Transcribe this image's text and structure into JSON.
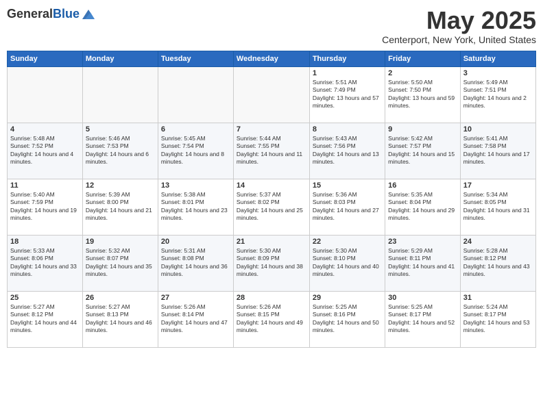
{
  "header": {
    "logo_general": "General",
    "logo_blue": "Blue",
    "month_title": "May 2025",
    "location": "Centerport, New York, United States"
  },
  "calendar": {
    "days_of_week": [
      "Sunday",
      "Monday",
      "Tuesday",
      "Wednesday",
      "Thursday",
      "Friday",
      "Saturday"
    ],
    "weeks": [
      [
        {
          "day": "",
          "info": ""
        },
        {
          "day": "",
          "info": ""
        },
        {
          "day": "",
          "info": ""
        },
        {
          "day": "",
          "info": ""
        },
        {
          "day": "1",
          "sunrise": "5:51 AM",
          "sunset": "7:49 PM",
          "daylight": "13 hours and 57 minutes."
        },
        {
          "day": "2",
          "sunrise": "5:50 AM",
          "sunset": "7:50 PM",
          "daylight": "13 hours and 59 minutes."
        },
        {
          "day": "3",
          "sunrise": "5:49 AM",
          "sunset": "7:51 PM",
          "daylight": "14 hours and 2 minutes."
        }
      ],
      [
        {
          "day": "4",
          "sunrise": "5:48 AM",
          "sunset": "7:52 PM",
          "daylight": "14 hours and 4 minutes."
        },
        {
          "day": "5",
          "sunrise": "5:46 AM",
          "sunset": "7:53 PM",
          "daylight": "14 hours and 6 minutes."
        },
        {
          "day": "6",
          "sunrise": "5:45 AM",
          "sunset": "7:54 PM",
          "daylight": "14 hours and 8 minutes."
        },
        {
          "day": "7",
          "sunrise": "5:44 AM",
          "sunset": "7:55 PM",
          "daylight": "14 hours and 11 minutes."
        },
        {
          "day": "8",
          "sunrise": "5:43 AM",
          "sunset": "7:56 PM",
          "daylight": "14 hours and 13 minutes."
        },
        {
          "day": "9",
          "sunrise": "5:42 AM",
          "sunset": "7:57 PM",
          "daylight": "14 hours and 15 minutes."
        },
        {
          "day": "10",
          "sunrise": "5:41 AM",
          "sunset": "7:58 PM",
          "daylight": "14 hours and 17 minutes."
        }
      ],
      [
        {
          "day": "11",
          "sunrise": "5:40 AM",
          "sunset": "7:59 PM",
          "daylight": "14 hours and 19 minutes."
        },
        {
          "day": "12",
          "sunrise": "5:39 AM",
          "sunset": "8:00 PM",
          "daylight": "14 hours and 21 minutes."
        },
        {
          "day": "13",
          "sunrise": "5:38 AM",
          "sunset": "8:01 PM",
          "daylight": "14 hours and 23 minutes."
        },
        {
          "day": "14",
          "sunrise": "5:37 AM",
          "sunset": "8:02 PM",
          "daylight": "14 hours and 25 minutes."
        },
        {
          "day": "15",
          "sunrise": "5:36 AM",
          "sunset": "8:03 PM",
          "daylight": "14 hours and 27 minutes."
        },
        {
          "day": "16",
          "sunrise": "5:35 AM",
          "sunset": "8:04 PM",
          "daylight": "14 hours and 29 minutes."
        },
        {
          "day": "17",
          "sunrise": "5:34 AM",
          "sunset": "8:05 PM",
          "daylight": "14 hours and 31 minutes."
        }
      ],
      [
        {
          "day": "18",
          "sunrise": "5:33 AM",
          "sunset": "8:06 PM",
          "daylight": "14 hours and 33 minutes."
        },
        {
          "day": "19",
          "sunrise": "5:32 AM",
          "sunset": "8:07 PM",
          "daylight": "14 hours and 35 minutes."
        },
        {
          "day": "20",
          "sunrise": "5:31 AM",
          "sunset": "8:08 PM",
          "daylight": "14 hours and 36 minutes."
        },
        {
          "day": "21",
          "sunrise": "5:30 AM",
          "sunset": "8:09 PM",
          "daylight": "14 hours and 38 minutes."
        },
        {
          "day": "22",
          "sunrise": "5:30 AM",
          "sunset": "8:10 PM",
          "daylight": "14 hours and 40 minutes."
        },
        {
          "day": "23",
          "sunrise": "5:29 AM",
          "sunset": "8:11 PM",
          "daylight": "14 hours and 41 minutes."
        },
        {
          "day": "24",
          "sunrise": "5:28 AM",
          "sunset": "8:12 PM",
          "daylight": "14 hours and 43 minutes."
        }
      ],
      [
        {
          "day": "25",
          "sunrise": "5:27 AM",
          "sunset": "8:12 PM",
          "daylight": "14 hours and 44 minutes."
        },
        {
          "day": "26",
          "sunrise": "5:27 AM",
          "sunset": "8:13 PM",
          "daylight": "14 hours and 46 minutes."
        },
        {
          "day": "27",
          "sunrise": "5:26 AM",
          "sunset": "8:14 PM",
          "daylight": "14 hours and 47 minutes."
        },
        {
          "day": "28",
          "sunrise": "5:26 AM",
          "sunset": "8:15 PM",
          "daylight": "14 hours and 49 minutes."
        },
        {
          "day": "29",
          "sunrise": "5:25 AM",
          "sunset": "8:16 PM",
          "daylight": "14 hours and 50 minutes."
        },
        {
          "day": "30",
          "sunrise": "5:25 AM",
          "sunset": "8:17 PM",
          "daylight": "14 hours and 52 minutes."
        },
        {
          "day": "31",
          "sunrise": "5:24 AM",
          "sunset": "8:17 PM",
          "daylight": "14 hours and 53 minutes."
        }
      ]
    ]
  }
}
